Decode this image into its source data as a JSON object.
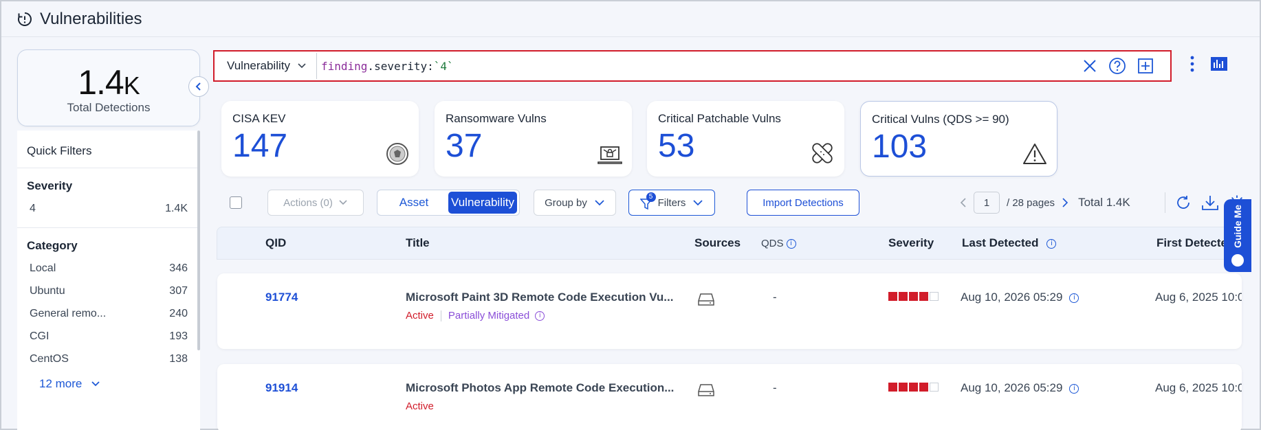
{
  "page": {
    "title": "Vulnerabilities"
  },
  "summary": {
    "total_value": "1.4",
    "total_suffix": "K",
    "total_label": "Total Detections"
  },
  "quick_filters": {
    "heading": "Quick Filters",
    "severity": {
      "heading": "Severity",
      "items": [
        {
          "label": "4",
          "count": "1.4K"
        }
      ]
    },
    "category": {
      "heading": "Category",
      "items": [
        {
          "label": "Local",
          "count": "346"
        },
        {
          "label": "Ubuntu",
          "count": "307"
        },
        {
          "label": "General remo...",
          "count": "240"
        },
        {
          "label": "CGI",
          "count": "193"
        },
        {
          "label": "CentOS",
          "count": "138"
        }
      ],
      "more_label": "12 more"
    }
  },
  "search": {
    "type_label": "Vulnerability",
    "query_key": "finding",
    "query_dot": ".",
    "query_field": "severity:",
    "query_value": "`4`"
  },
  "stats": [
    {
      "label": "CISA KEV",
      "value": "147",
      "icon": "cisa-seal-icon"
    },
    {
      "label": "Ransomware Vulns",
      "value": "37",
      "icon": "ransomware-laptop-icon"
    },
    {
      "label": "Critical Patchable Vulns",
      "value": "53",
      "icon": "bandage-icon"
    },
    {
      "label": "Critical Vulns (QDS >= 90)",
      "value": "103",
      "icon": "warning-icon"
    }
  ],
  "toolbar": {
    "actions_label": "Actions (0)",
    "view_asset": "Asset",
    "view_vulnerability": "Vulnerability",
    "group_by": "Group by",
    "filters_label": "Filters",
    "filters_count": "5",
    "import_label": "Import Detections",
    "page_current": "1",
    "page_total": "/ 28 pages",
    "total_label": "Total 1.4K"
  },
  "table": {
    "headers": {
      "qid": "QID",
      "title": "Title",
      "sources": "Sources",
      "qds": "QDS",
      "severity": "Severity",
      "last_detected": "Last Detected",
      "first_detected": "First Detecte"
    },
    "rows": [
      {
        "qid": "91774",
        "title": "Microsoft Paint 3D Remote Code Execution Vu...",
        "status": "Active",
        "mitigation": "Partially Mitigated",
        "qds": "-",
        "severity_level": 4,
        "last_detected": "Aug 10, 2026 05:29",
        "first_detected": "Aug 6, 2025 10:0"
      },
      {
        "qid": "91914",
        "title": "Microsoft Photos App Remote Code Execution...",
        "status": "Active",
        "mitigation": "",
        "qds": "-",
        "severity_level": 4,
        "last_detected": "Aug 10, 2026 05:29",
        "first_detected": "Aug 6, 2025 10:0"
      }
    ]
  },
  "guide": {
    "label": "Guide Me"
  },
  "colors": {
    "accent": "#1d4fd6",
    "danger": "#d11c2a",
    "mitigated": "#8a4ed8"
  }
}
